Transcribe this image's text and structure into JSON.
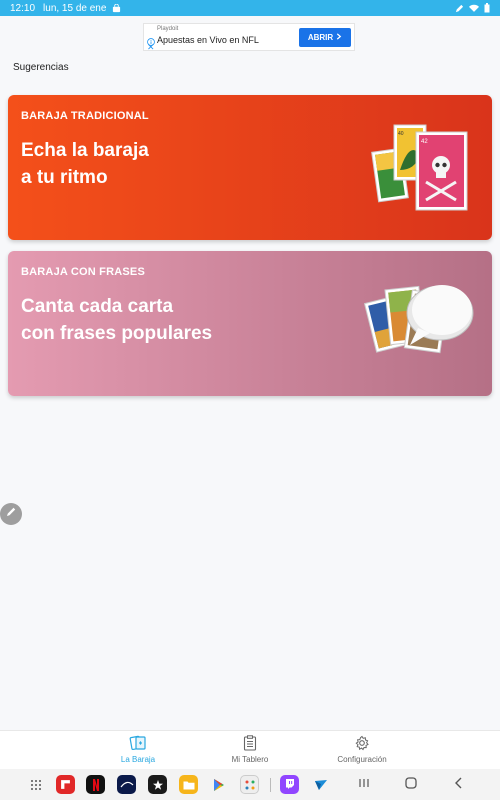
{
  "status_bar": {
    "time": "12:10",
    "date": "lun, 15 de ene"
  },
  "ad": {
    "advertiser": "Playdoit",
    "headline": "Apuestas en Vivo en NFL",
    "button_label": "ABRIR"
  },
  "section_title": "Sugerencias",
  "cards": [
    {
      "label": "BARAJA TRADICIONAL",
      "line1": "Echa la baraja",
      "line2": "a tu ritmo"
    },
    {
      "label": "BARAJA CON FRASES",
      "line1": "Canta cada carta",
      "line2": "con frases populares"
    }
  ],
  "nav": [
    {
      "label": "La Baraja",
      "icon": "cards-icon",
      "active": true
    },
    {
      "label": "Mi Tablero",
      "icon": "clipboard-icon",
      "active": false
    },
    {
      "label": "Configuración",
      "icon": "gear-icon",
      "active": false
    }
  ],
  "dock_apps": [
    "apps-grid-icon",
    "flipboard-icon",
    "netflix-icon",
    "disney-plus-icon",
    "star-plus-icon",
    "files-icon",
    "play-store-icon",
    "multi-apps-icon",
    "twitch-icon",
    "app-icon"
  ],
  "colors": {
    "status_bar": "#33b4ea",
    "card_1_start": "#f4501a",
    "card_1_end": "#d9341b",
    "card_2_start": "#e49bb1",
    "card_2_end": "#b57086",
    "accent": "#2aa8e0"
  }
}
